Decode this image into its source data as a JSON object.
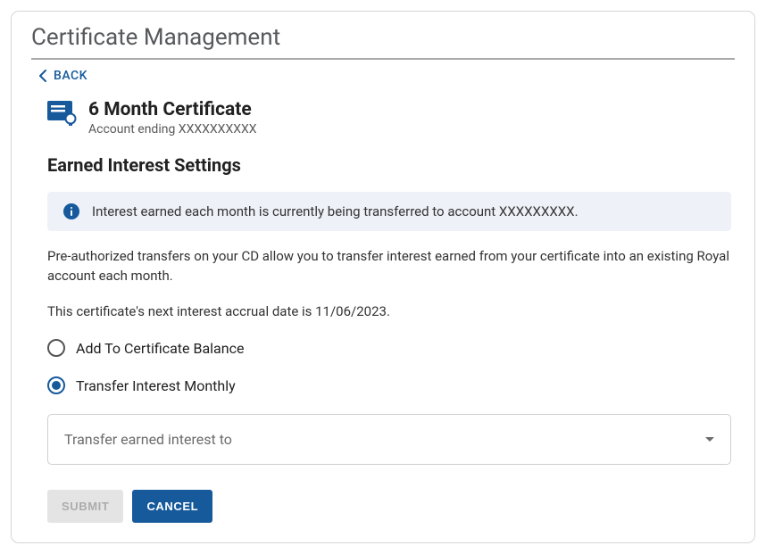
{
  "page": {
    "title": "Certificate Management"
  },
  "nav": {
    "back_label": "BACK"
  },
  "certificate": {
    "name": "6 Month Certificate",
    "subtitle": "Account ending XXXXXXXXXX"
  },
  "section": {
    "title": "Earned Interest Settings"
  },
  "info_banner": {
    "text": "Interest earned each month is currently being transferred to account XXXXXXXXX."
  },
  "description": {
    "paragraph1": "Pre-authorized transfers on your CD allow you to transfer interest earned from your certificate into an existing Royal account each month.",
    "paragraph2": "This certificate's next interest accrual date is 11/06/2023."
  },
  "options": {
    "add_to_balance": "Add To Certificate Balance",
    "transfer_monthly": "Transfer Interest Monthly"
  },
  "select": {
    "placeholder": "Transfer earned interest to"
  },
  "actions": {
    "submit": "SUBMIT",
    "cancel": "CANCEL"
  }
}
